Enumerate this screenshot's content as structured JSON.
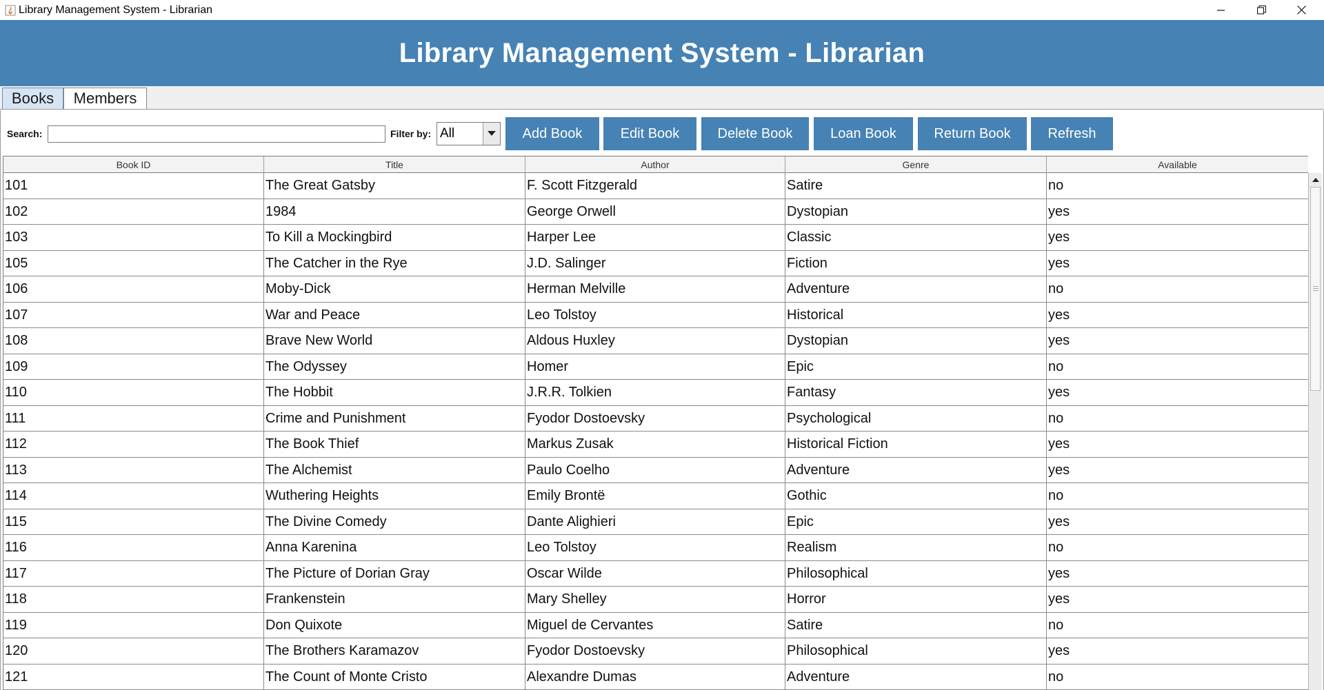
{
  "window": {
    "title": "Library Management System - Librarian",
    "controls": [
      "minimize",
      "restore",
      "close"
    ]
  },
  "banner": {
    "title": "Library Management System - Librarian"
  },
  "tabs": [
    {
      "label": "Books",
      "active": true
    },
    {
      "label": "Members",
      "active": false
    }
  ],
  "toolbar": {
    "search_label": "Search:",
    "search_value": "",
    "filter_label": "Filter by:",
    "filter_value": "All",
    "buttons": {
      "add": "Add Book",
      "edit": "Edit Book",
      "delete": "Delete Book",
      "loan": "Loan Book",
      "return": "Return Book",
      "refresh": "Refresh"
    }
  },
  "colors": {
    "accent": "#4682b4",
    "header_text": "#ffffff"
  },
  "table": {
    "columns": [
      "Book ID",
      "Title",
      "Author",
      "Genre",
      "Available"
    ],
    "rows": [
      [
        "101",
        "The Great Gatsby",
        "F. Scott Fitzgerald",
        "Satire",
        "no"
      ],
      [
        "102",
        "1984",
        "George Orwell",
        "Dystopian",
        "yes"
      ],
      [
        "103",
        "To Kill a Mockingbird",
        "Harper Lee",
        "Classic",
        "yes"
      ],
      [
        "105",
        "The Catcher in the Rye",
        "J.D. Salinger",
        "Fiction",
        "yes"
      ],
      [
        "106",
        "Moby-Dick",
        "Herman Melville",
        "Adventure",
        "no"
      ],
      [
        "107",
        "War and Peace",
        "Leo Tolstoy",
        "Historical",
        "yes"
      ],
      [
        "108",
        "Brave New World",
        "Aldous Huxley",
        "Dystopian",
        "yes"
      ],
      [
        "109",
        "The Odyssey",
        "Homer",
        "Epic",
        "no"
      ],
      [
        "110",
        "The Hobbit",
        "J.R.R. Tolkien",
        "Fantasy",
        "yes"
      ],
      [
        "111",
        "Crime and Punishment",
        "Fyodor Dostoevsky",
        "Psychological",
        "no"
      ],
      [
        "112",
        "The Book Thief",
        "Markus Zusak",
        "Historical Fiction",
        "yes"
      ],
      [
        "113",
        "The Alchemist",
        "Paulo Coelho",
        "Adventure",
        "yes"
      ],
      [
        "114",
        "Wuthering Heights",
        "Emily Brontë",
        "Gothic",
        "no"
      ],
      [
        "115",
        "The Divine Comedy",
        "Dante Alighieri",
        "Epic",
        "yes"
      ],
      [
        "116",
        "Anna Karenina",
        "Leo Tolstoy",
        "Realism",
        "no"
      ],
      [
        "117",
        "The Picture of Dorian Gray",
        "Oscar Wilde",
        "Philosophical",
        "yes"
      ],
      [
        "118",
        "Frankenstein",
        "Mary Shelley",
        "Horror",
        "yes"
      ],
      [
        "119",
        "Don Quixote",
        "Miguel de Cervantes",
        "Satire",
        "no"
      ],
      [
        "120",
        "The Brothers Karamazov",
        "Fyodor Dostoevsky",
        "Philosophical",
        "yes"
      ],
      [
        "121",
        "The Count of Monte Cristo",
        "Alexandre Dumas",
        "Adventure",
        "no"
      ]
    ]
  }
}
